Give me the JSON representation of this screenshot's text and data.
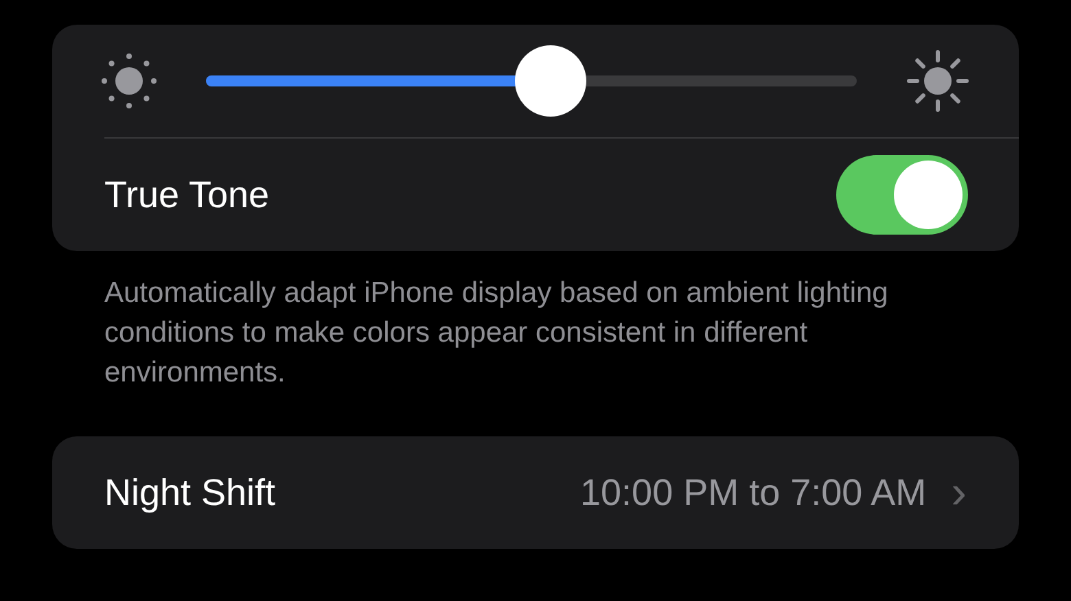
{
  "brightness": {
    "level": 0.53
  },
  "true_tone": {
    "label": "True Tone",
    "on": true
  },
  "footer": "Automatically adapt iPhone display based on ambient lighting conditions to make colors appear consistent in different environments.",
  "night_shift": {
    "label": "Night Shift",
    "value": "10:00 PM to 7:00 AM",
    "chevron": "›"
  }
}
